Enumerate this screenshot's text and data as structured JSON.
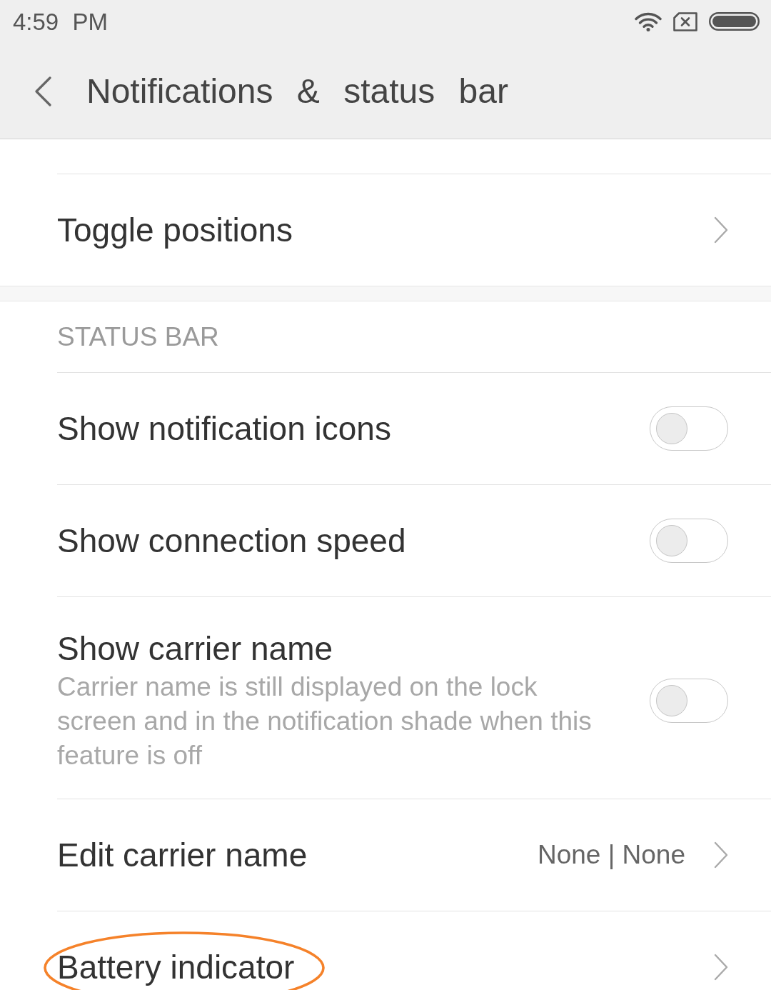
{
  "status_bar": {
    "time": "4:59 PM"
  },
  "header": {
    "title": "Notifications & status bar"
  },
  "sections": [
    {
      "items": [
        {
          "kind": "link",
          "label": "Toggle positions"
        }
      ]
    },
    {
      "heading": "STATUS BAR",
      "items": [
        {
          "kind": "switch",
          "label": "Show notification icons",
          "on": false
        },
        {
          "kind": "switch",
          "label": "Show connection speed",
          "on": false
        },
        {
          "kind": "switch",
          "label": "Show carrier name",
          "description": "Carrier name is still displayed on the lock screen and in the notification shade when this feature is off",
          "on": false
        },
        {
          "kind": "link",
          "label": "Edit carrier name",
          "value": "None | None"
        },
        {
          "kind": "link",
          "label": "Battery indicator",
          "highlighted": true
        }
      ]
    }
  ]
}
